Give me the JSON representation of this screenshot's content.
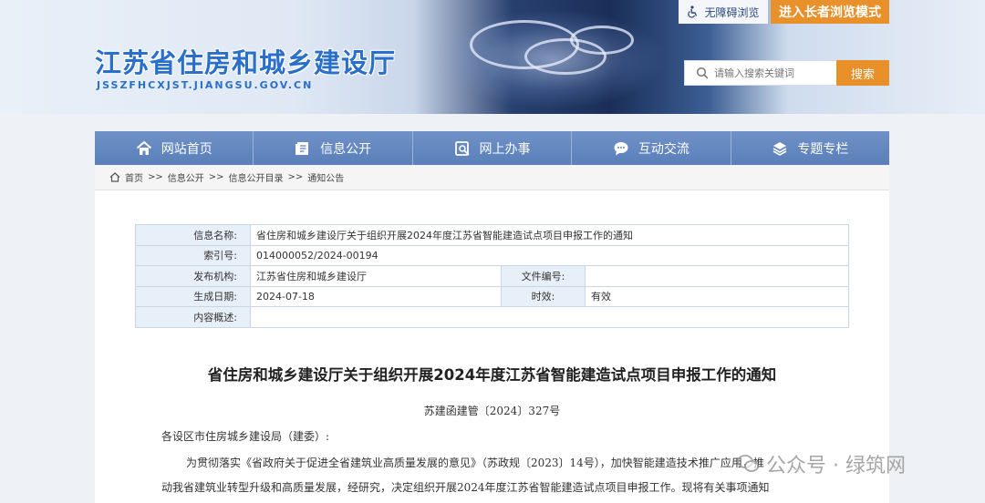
{
  "header": {
    "site_title": "江苏省住房和城乡建设厅",
    "site_domain": "JSSZFHCXJST.JIANGSU.GOV.CN",
    "a11y_label": "无障碍浏览",
    "elder_mode_label": "进入长者浏览模式",
    "search_placeholder": "请输入搜索关键词",
    "search_button": "搜索"
  },
  "nav": {
    "items": [
      {
        "label": "网站首页",
        "icon": "home-icon"
      },
      {
        "label": "信息公开",
        "icon": "document-icon"
      },
      {
        "label": "网上办事",
        "icon": "service-icon"
      },
      {
        "label": "互动交流",
        "icon": "chat-icon"
      },
      {
        "label": "专题专栏",
        "icon": "layers-icon"
      }
    ]
  },
  "breadcrumb": {
    "items": [
      "首页",
      "信息公开",
      "信息公开目录",
      "通知公告"
    ],
    "separator": ">>"
  },
  "info_table": {
    "name_label": "信息名称:",
    "name_value": "省住房和城乡建设厅关于组织开展2024年度江苏省智能建造试点项目申报工作的通知",
    "index_label": "索引号:",
    "index_value": "014000052/2024-00194",
    "org_label": "发布机构:",
    "org_value": "江苏省住房和城乡建设厅",
    "docno_label": "文件编号:",
    "docno_value": "",
    "date_label": "生成日期:",
    "date_value": "2024-07-18",
    "validity_label": "时效:",
    "validity_value": "有效",
    "summary_label": "内容概述:",
    "summary_value": ""
  },
  "article": {
    "title": "省住房和城乡建设厅关于组织开展2024年度江苏省智能建造试点项目申报工作的通知",
    "doc_number": "苏建函建管〔2024〕327号",
    "salutation": "各设区市住房城乡建设局（建委）:",
    "para1_line1": "为贯彻落实《省政府关于促进全省建筑业高质量发展的意见》（苏政规〔2023〕14号），加快智能建造技术推广应用，推",
    "para1_line2": "动我省建筑业转型升级和高质量发展，经研究，决定组织开展2024年度江苏省智能建造试点项目申报工作。现将有关事项通知"
  },
  "watermark": {
    "text": "公众号 · 绿筑网"
  },
  "colors": {
    "brand_blue": "#2a6fc9",
    "nav_blue": "#6485c0",
    "accent_orange": "#e8902a",
    "table_label_bg": "#e7eff8"
  }
}
